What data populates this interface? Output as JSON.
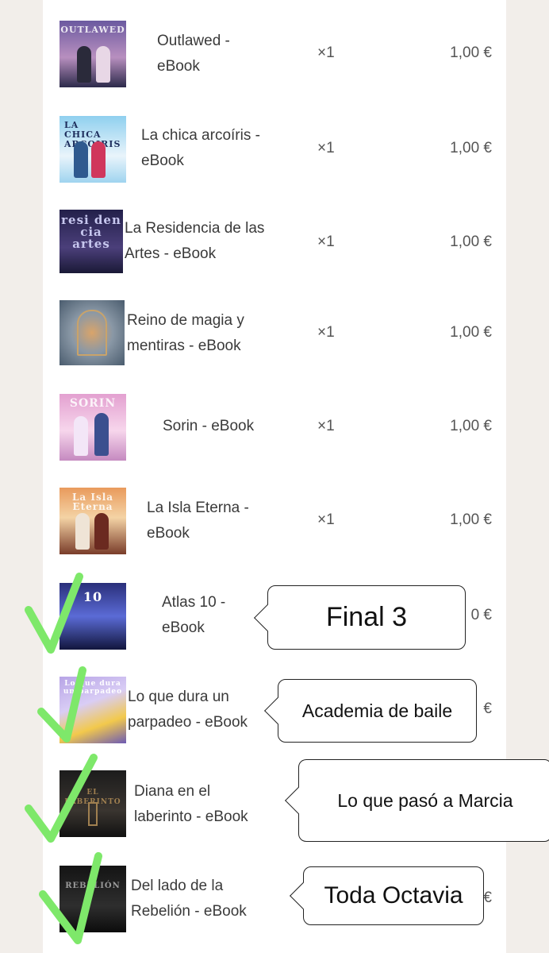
{
  "cart": {
    "items": [
      {
        "title_lines": [
          "Outlawed -",
          "eBook"
        ],
        "qty": "×1",
        "price": "1,00 €",
        "cover_text": "OUTLAWED",
        "cover_colors": [
          "#6b5aa0",
          "#b88fbf",
          "#2c2a4a"
        ]
      },
      {
        "title_lines": [
          "La chica arcoíris -",
          "eBook"
        ],
        "qty": "×1",
        "price": "1,00 €",
        "cover_text": "LA CHICA ARCOIRIS",
        "cover_colors": [
          "#8fd0ef",
          "#e9f4fb",
          "#d0365c"
        ]
      },
      {
        "title_lines": [
          "La Residencia de las",
          "Artes - eBook"
        ],
        "qty": "×1",
        "price": "1,00 €",
        "cover_text": "resi den cia artes",
        "cover_colors": [
          "#23204a",
          "#4b3f7a",
          "#a1a2d6"
        ]
      },
      {
        "title_lines": [
          "Reino de magia y",
          "mentiras - eBook"
        ],
        "qty": "×1",
        "price": "1,00 €",
        "cover_text": "",
        "cover_colors": [
          "#4a5c6e",
          "#8a98a6",
          "#d9a46a"
        ]
      },
      {
        "title_lines": [
          "Sorin - eBook"
        ],
        "qty": "×1",
        "price": "1,00 €",
        "cover_text": "SORIN",
        "cover_colors": [
          "#e3a0d0",
          "#f7d6ec",
          "#3b4f8f"
        ]
      },
      {
        "title_lines": [
          "La Isla Eterna -",
          "eBook"
        ],
        "qty": "×1",
        "price": "1,00 €",
        "cover_text": "La Isla Eterna",
        "cover_colors": [
          "#e99a5c",
          "#f4d3a5",
          "#7a3d2a"
        ]
      },
      {
        "title_lines": [
          "Atlas 10 -",
          "eBook"
        ],
        "qty": "",
        "price": "0 €",
        "cover_text": "10",
        "cover_colors": [
          "#2a2f7a",
          "#5b6bd6",
          "#12163d"
        ]
      },
      {
        "title_lines": [
          "Lo que dura un",
          "parpadeo - eBook"
        ],
        "qty": "",
        "price": "€",
        "cover_text": "Lo que dura un parpadeo",
        "cover_colors": [
          "#b7a4e6",
          "#f2c94c",
          "#6d5bb5"
        ]
      },
      {
        "title_lines": [
          "Diana en el",
          "laberinto - eBook"
        ],
        "qty": "",
        "price": "",
        "cover_text": "EL LABERINTO",
        "cover_colors": [
          "#1c1c1c",
          "#3a3530",
          "#a08050"
        ]
      },
      {
        "title_lines": [
          "Del lado de la",
          "Rebelión - eBook"
        ],
        "qty": "",
        "price": "€",
        "cover_text": "REBELIÓN",
        "cover_colors": [
          "#141414",
          "#2e2e2e",
          "#7a7a7a"
        ]
      }
    ]
  },
  "notes": [
    {
      "text": "Final 3"
    },
    {
      "text": "Academia de baile"
    },
    {
      "text": "Lo que pasó a Marcia"
    },
    {
      "text": "Toda Octavia"
    }
  ],
  "colors": {
    "checkmark": "#7ee86a",
    "background": "#f2eeea",
    "card": "#ffffff"
  },
  "icons": {
    "checkmark": "checkmark-icon"
  }
}
